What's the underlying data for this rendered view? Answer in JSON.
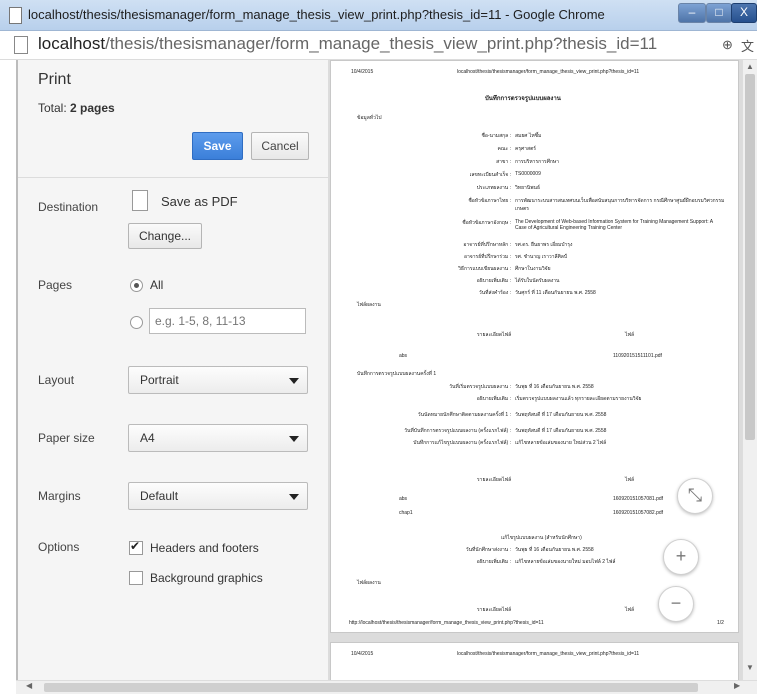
{
  "window": {
    "title": "localhost/thesis/thesismanager/form_manage_thesis_view_print.php?thesis_id=11 - Google Chrome",
    "min_symbol": "–",
    "max_symbol": "□",
    "close_symbol": "X",
    "icon": "page-icon"
  },
  "address": {
    "host": "localhost",
    "path": "/thesis/thesismanager/form_manage_thesis_view_print.php?thesis_id=11",
    "zoom_icon": "⊕",
    "translate_icon": "文"
  },
  "print": {
    "title": "Print",
    "total_label": "Total:",
    "total_value": "2 pages",
    "save_label": "Save",
    "cancel_label": "Cancel",
    "destination": {
      "label": "Destination",
      "value": "Save as PDF",
      "change_label": "Change..."
    },
    "pages": {
      "label": "Pages",
      "all_label": "All",
      "range_placeholder": "e.g. 1-5, 8, 11-13"
    },
    "layout": {
      "label": "Layout",
      "value": "Portrait"
    },
    "paper_size": {
      "label": "Paper size",
      "value": "A4"
    },
    "margins": {
      "label": "Margins",
      "value": "Default"
    },
    "options": {
      "label": "Options",
      "headers_footers": "Headers and footers",
      "headers_footers_checked": true,
      "background_graphics": "Background graphics",
      "background_graphics_checked": false
    }
  },
  "preview": {
    "header_date": "10/4/2015",
    "header_url": "localhost/thesis/thesismanager/form_manage_thesis_view_print.php?thesis_id=11",
    "footer_url": "http://localhost/thesis/thesismanager/form_manage_thesis_view_print.php?thesis_id=11",
    "footer_page": "1/2",
    "page2_date": "10/4/2015",
    "page2_url": "localhost/thesis/thesismanager/form_manage_thesis_view_print.php?thesis_id=11",
    "heading": "บันทึกการตรวจรูปแบบผลงาน",
    "section_info": "ข้อมูลทั่วไป",
    "fields": [
      {
        "label": "ชื่อ-นามสกุล :",
        "value": "สมยศ ไหซึ้ม"
      },
      {
        "label": "คณะ :",
        "value": "ครุศาสตร์"
      },
      {
        "label": "สาขา :",
        "value": "การบริหารการศึกษา"
      },
      {
        "label": "เลขทะเบียนสำเร็จ :",
        "value": "TS0000009"
      },
      {
        "label": "ประเภทผลงาน :",
        "value": "วิทยานิพนธ์"
      },
      {
        "label": "ชื่อหัวข้อภาษาไทย :",
        "value": "การพัฒนาระบบสารสนเทศบนเว็บเพื่อสนับสนุนการบริหารจัดการ กรณีศึกษาศูนย์ฝึกอบรมวิศวกรรมเกษตร"
      },
      {
        "label": "ชื่อหัวข้อภาษาอังกฤษ :",
        "value": "The Development of Web-based Information System for Training Management Support: A Case of Agricultural Engineering Training Center"
      },
      {
        "label": "อาจารย์ที่ปรึกษาหลัก :",
        "value": "รศ.ดร. ยืนยาพร เอี่ยมบำรุง"
      },
      {
        "label": "อาจารย์ที่ปรึกษาร่วม :",
        "value": "รศ. ชำนาญ เราวาลีศิลป์"
      },
      {
        "label": "วิธีการแบบเขียนผลงาน :",
        "value": "ศึกษาในงานวิจัย"
      },
      {
        "label": "อธิบายเพิ่มเติม :",
        "value": "ได้รับใบนัดรับผลงาน"
      },
      {
        "label": "วันที่ส่งคำร้อง :",
        "value": "วันศุกร์ ที่ 11 เดือนกันยายน พ.ศ. 2558"
      }
    ],
    "section_files": "ไฟล์ผลงาน",
    "files_header": {
      "name": "รายละเอียดไฟล์",
      "file": "ไฟล์"
    },
    "file_rows_1": [
      {
        "name": "abs",
        "file": "110920151511101.pdf"
      }
    ],
    "section_check1": "บันทึกการตรวจรูปแบบผลงานครั้งที่ 1",
    "check1_fields": [
      {
        "label": "วันที่เริ่มตรวจรูปแบบผลงาน :",
        "value": "วันพุธ ที่ 16 เดือนกันยายน พ.ศ. 2558"
      },
      {
        "label": "อธิบายเพิ่มเติม :",
        "value": "เริ่มตรวจรูปแบบผลงานแล้ว ทุกรายละเอียดตามรายงานวิจัย"
      },
      {
        "label": "วันนัดหมายนักศึกษาติดตามผลงานครั้งที่ 1 :",
        "value": "วันพฤหัสบดี ที่ 17 เดือนกันยายน พ.ศ. 2558"
      },
      {
        "label": "วันที่บันทึกการตรวจรูปแบบผลงาน (ครั้งแรกไฟล์) :",
        "value": "วันพฤหัสบดี ที่ 17 เดือนกันยายน พ.ศ. 2558"
      },
      {
        "label": "บันทึกการแก้ไขรูปแบบผลงาน (ครั้งแรกไฟล์) :",
        "value": "แก้ไขหลายข้อเล่มของนาย ใหม่ส่วน 2 ไฟล์"
      }
    ],
    "file_rows_2": [
      {
        "name": "abs",
        "file": "160920151057081.pdf"
      },
      {
        "name": "chap1",
        "file": "160920151057082.pdf"
      }
    ],
    "section_fix": "แก้ไขรูปแบบผลงาน (สำหรับนักศึกษา)",
    "fix_fields": [
      {
        "label": "วันที่นักศึกษาส่งงาน :",
        "value": "วันพุธ ที่ 16 เดือนกันยายน พ.ศ. 2558"
      },
      {
        "label": "อธิบายเพิ่มเติม :",
        "value": "แก้ไขหลายข้อเล่มของนายใหม่ มอบไฟล์ 2 ไฟล์"
      }
    ],
    "section_files3": "ไฟล์ผลงาน",
    "files_header3": {
      "name": "รายละเอียดไฟล์",
      "file": "ไฟล์"
    }
  },
  "controls": {
    "fit_icon": "⤡",
    "zoom_in": "+",
    "zoom_out": "−"
  }
}
